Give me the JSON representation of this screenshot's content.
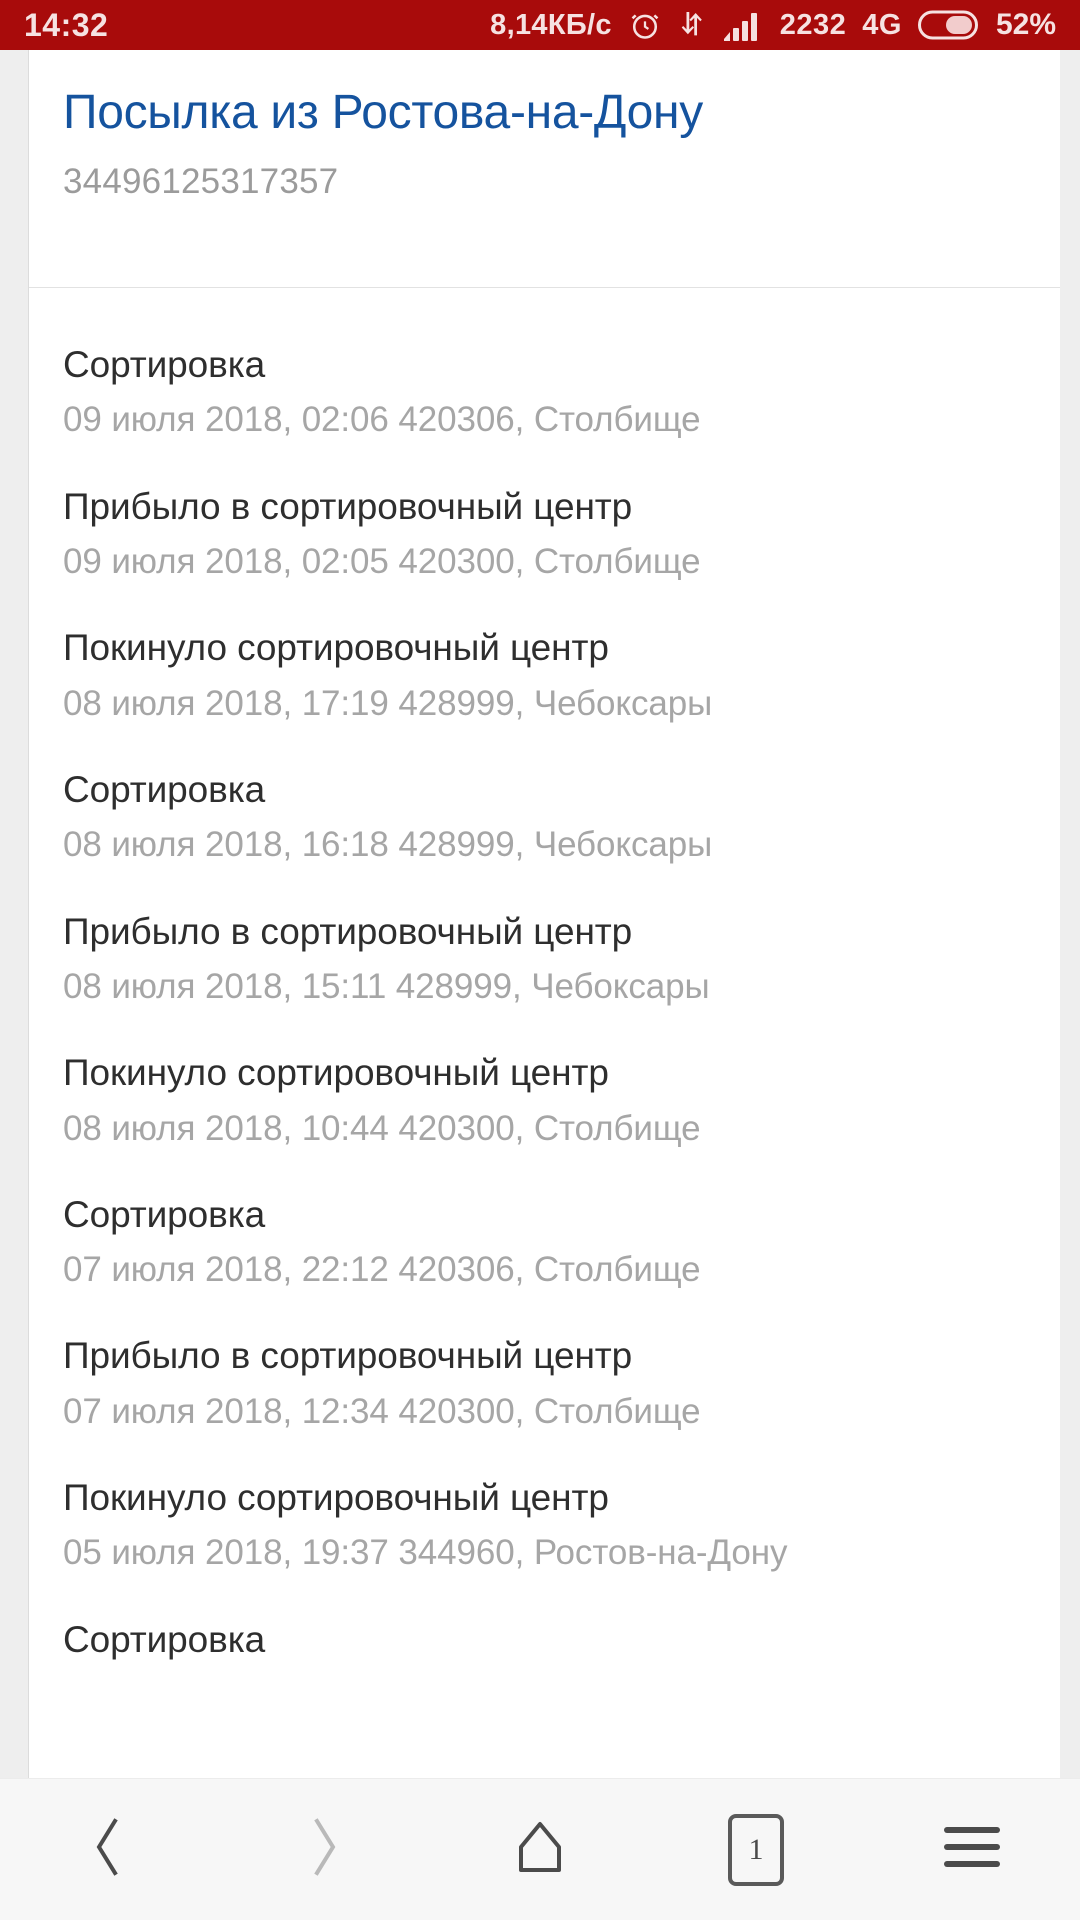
{
  "statusbar": {
    "clock": "14:32",
    "data_speed": "8,14КБ/с",
    "alarm_icon": "alarm-clock-icon",
    "data_transfer_icon": "data-transfer-arrows-icon",
    "signal_icon": "signal-bars-icon",
    "sim_label": "2232",
    "network": "4G",
    "battery_icon": "battery-icon",
    "battery_percent": "52%",
    "background_color": "#a80b0b",
    "text_color": "#f6e2e2"
  },
  "page": {
    "title": "Посылка из Ростова-на-Дону",
    "title_color": "#15539e",
    "tracking_number": "34496125317357",
    "events": [
      {
        "status": "Сортировка",
        "meta": "09 июля 2018, 02:06 420306, Столбище"
      },
      {
        "status": "Прибыло в сортировочный центр",
        "meta": "09 июля 2018, 02:05 420300, Столбище"
      },
      {
        "status": "Покинуло сортировочный центр",
        "meta": "08 июля 2018, 17:19 428999, Чебоксары"
      },
      {
        "status": "Сортировка",
        "meta": "08 июля 2018, 16:18 428999, Чебоксары"
      },
      {
        "status": "Прибыло в сортировочный центр",
        "meta": "08 июля 2018, 15:11 428999, Чебоксары"
      },
      {
        "status": "Покинуло сортировочный центр",
        "meta": "08 июля 2018, 10:44 420300, Столбище"
      },
      {
        "status": "Сортировка",
        "meta": "07 июля 2018, 22:12 420306, Столбище"
      },
      {
        "status": "Прибыло в сортировочный центр",
        "meta": "07 июля 2018, 12:34 420300, Столбище"
      },
      {
        "status": "Покинуло сортировочный центр",
        "meta": "05 июля 2018, 19:37 344960, Ростов-на-Дону"
      },
      {
        "status": "Сортировка",
        "meta": ""
      }
    ]
  },
  "navbar": {
    "back_icon": "chevron-left-icon",
    "forward_icon": "chevron-right-icon",
    "home_icon": "home-icon",
    "tabs_icon": "tab-count-icon",
    "tabs_count": "1",
    "menu_icon": "hamburger-menu-icon"
  }
}
